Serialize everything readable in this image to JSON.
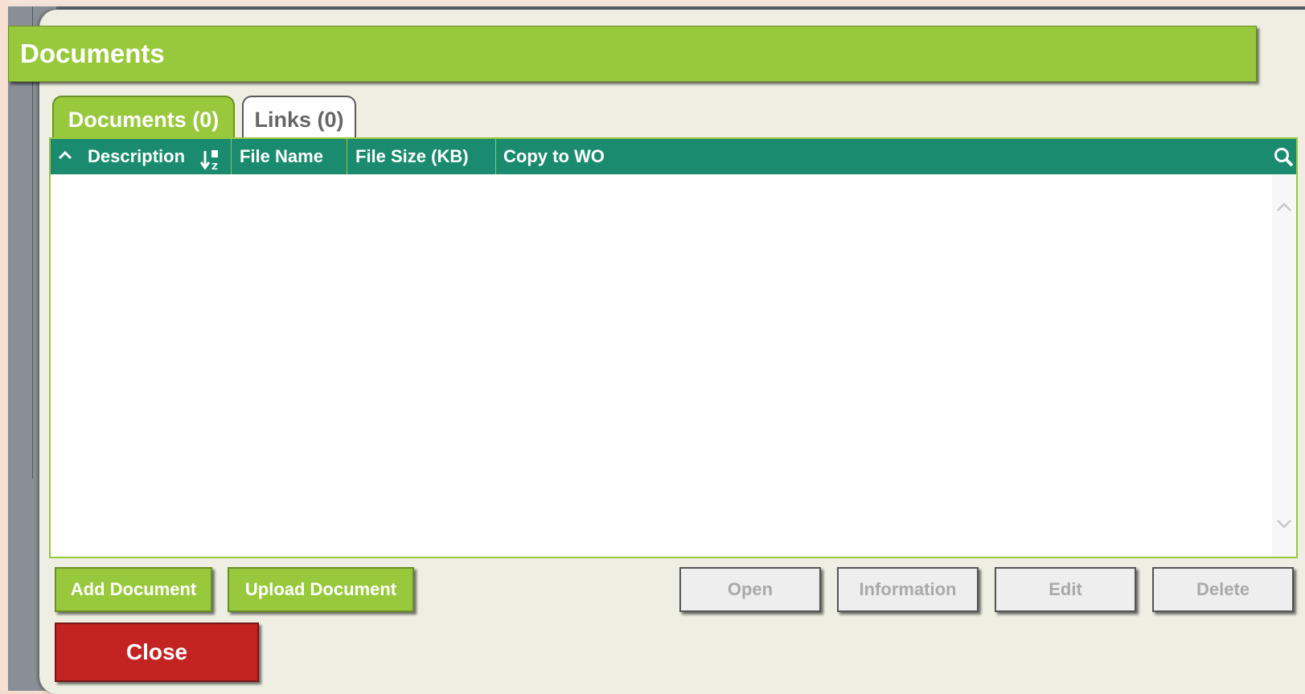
{
  "dialog": {
    "title": "Documents",
    "tabs": [
      {
        "label": "Documents (0)",
        "active": true
      },
      {
        "label": "Links (0)",
        "active": false
      }
    ],
    "grid": {
      "columns": [
        "Description",
        "File Name",
        "File Size (KB)",
        "Copy to WO"
      ],
      "rows": []
    },
    "buttons": {
      "add_document": "Add Document",
      "upload_document": "Upload Document",
      "open": "Open",
      "information": "Information",
      "edit": "Edit",
      "delete": "Delete",
      "close": "Close"
    }
  },
  "colors": {
    "title_green": "#98c93c",
    "header_teal": "#1a8b6e",
    "close_red": "#c42323"
  },
  "icons": [
    "chevron-up-icon",
    "sort-az-icon",
    "search-icon",
    "scroll-up-icon",
    "scroll-down-icon"
  ]
}
